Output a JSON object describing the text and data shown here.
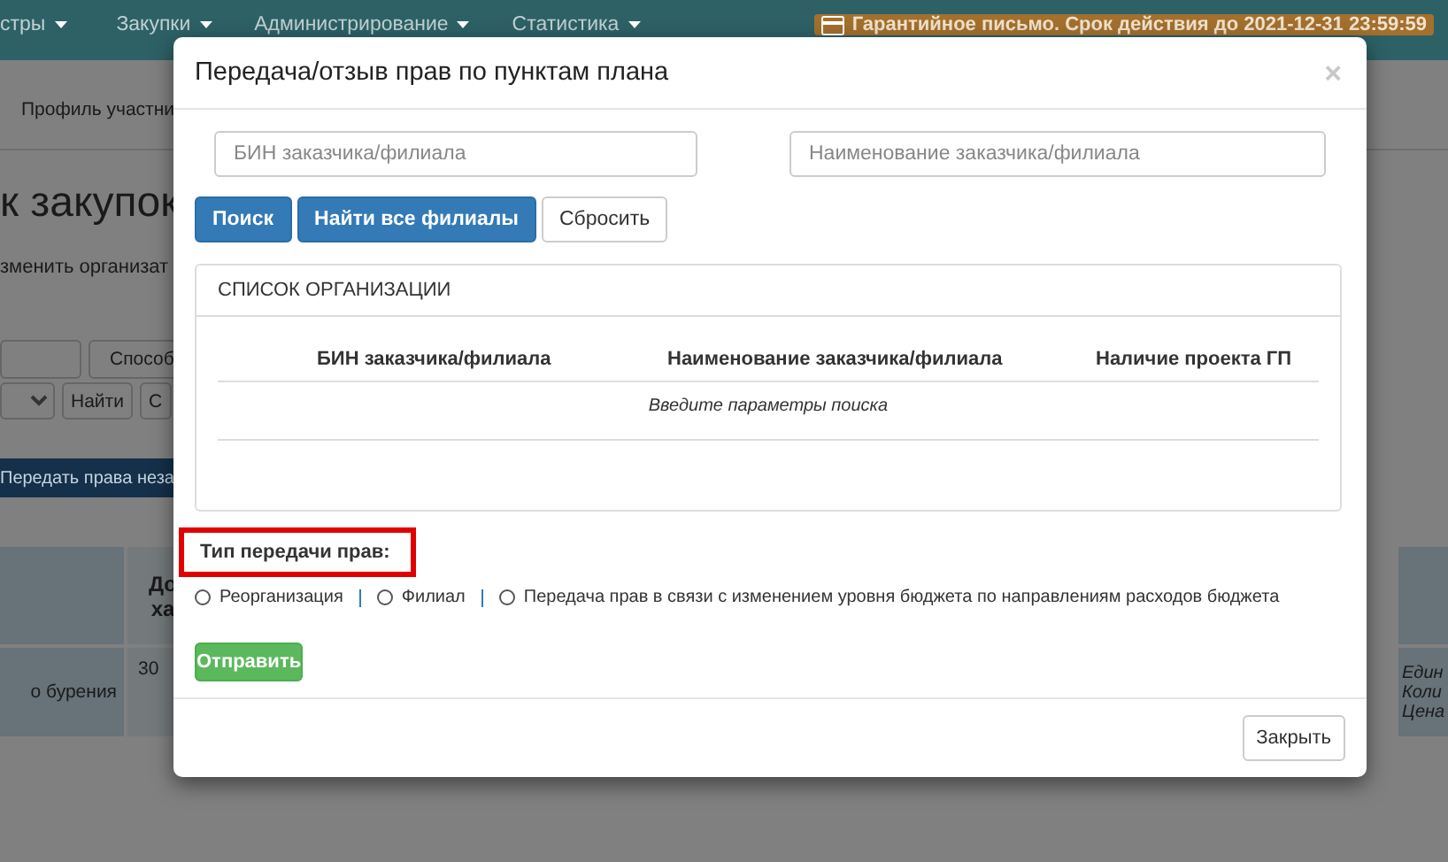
{
  "navbar": {
    "items": [
      {
        "label": "стры"
      },
      {
        "label": "Закупки"
      },
      {
        "label": "Администрирование"
      },
      {
        "label": "Статистика"
      }
    ],
    "notice": "Гарантийное письмо. Срок действия до 2021-12-31 23:59:59"
  },
  "breadcrumb": "Профиль участни",
  "page_title": "к закупок",
  "change_link": "зменить организат",
  "filter": {
    "method_label": "Способ",
    "find_button": "Найти",
    "cut_button": "С"
  },
  "transfer_button": "Передать права неза",
  "table": {
    "header": [
      "До",
      "ха"
    ],
    "row": {
      "name": "о бурения",
      "number": "30",
      "right": [
        "Един",
        "Коли",
        "Цена"
      ]
    }
  },
  "modal": {
    "title": "Передача/отзыв прав по пунктам плана",
    "close": "×",
    "fields": [
      {
        "placeholder": "БИН заказчика/филиала"
      },
      {
        "placeholder": "Наименование заказчика/филиала"
      }
    ],
    "buttons": [
      {
        "label": "Поиск",
        "kind": "primary"
      },
      {
        "label": "Найти все филиалы",
        "kind": "primary"
      },
      {
        "label": "Сбросить",
        "kind": "default"
      }
    ],
    "panel": {
      "heading": "СПИСОК ОРГАНИЗАЦИИ",
      "columns": [
        "БИН заказчика/филиала",
        "Наименование заказчика/филиала",
        "Наличие проекта ГП"
      ],
      "empty": "Введите параметры поиска"
    },
    "transfer_type": {
      "label": "Тип передачи прав:",
      "highlighted": true,
      "options": [
        {
          "label": "Реорганизация",
          "selected": false
        },
        {
          "label": "Филиал",
          "selected": false
        },
        {
          "label": "Передача прав в связи с изменением уровня бюджета по направлениям расходов бюджета",
          "selected": false
        }
      ]
    },
    "submit": "Отправить",
    "footer_button": "Закрыть"
  }
}
